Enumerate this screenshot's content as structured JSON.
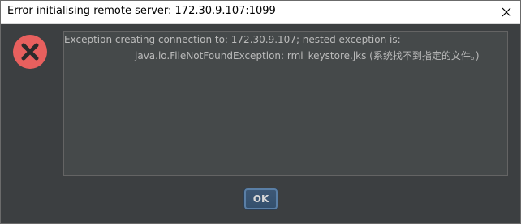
{
  "window": {
    "title": "Error initialising remote server: 172.30.9.107:1099",
    "close_icon": "close-icon"
  },
  "dialog": {
    "icon": "error-icon",
    "icon_color": "#e8605e",
    "message_line1": "Exception creating connection to: 172.30.9.107; nested exception is:",
    "message_line2": "java.io.FileNotFoundException: rmi_keystore.jks (系统找不到指定的文件。)",
    "ok_label": "OK"
  },
  "colors": {
    "background": "#3c3f41",
    "text": "#bbbbbb",
    "button_accent": "#5a7fa6"
  }
}
